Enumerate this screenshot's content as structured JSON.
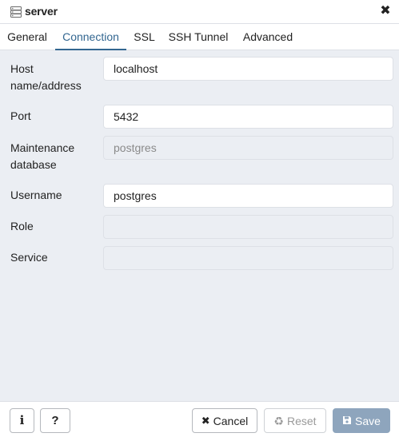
{
  "dialog": {
    "title": "server",
    "title_icon": "server-icon",
    "close_icon": "close-icon"
  },
  "tabs": [
    {
      "label": "General",
      "active": false
    },
    {
      "label": "Connection",
      "active": true
    },
    {
      "label": "SSL",
      "active": false
    },
    {
      "label": "SSH Tunnel",
      "active": false
    },
    {
      "label": "Advanced",
      "active": false
    }
  ],
  "form": {
    "host": {
      "label_line1": "Host",
      "label_line2": "name/address",
      "value": "localhost"
    },
    "port": {
      "label": "Port",
      "value": "5432"
    },
    "maintenance_db": {
      "label_line1": "Maintenance",
      "label_line2": "database",
      "value": "postgres",
      "disabled": true
    },
    "username": {
      "label": "Username",
      "value": "postgres"
    },
    "role": {
      "label": "Role",
      "value": "",
      "disabled": true
    },
    "service": {
      "label": "Service",
      "value": "",
      "disabled": true
    }
  },
  "footer": {
    "info_icon": "info-icon",
    "help_icon": "help-icon",
    "cancel_label": "Cancel",
    "reset_label": "Reset",
    "save_label": "Save"
  },
  "colors": {
    "accent": "#326690",
    "content_bg": "#ebeef3",
    "save_disabled_bg": "#8ea5bd"
  }
}
